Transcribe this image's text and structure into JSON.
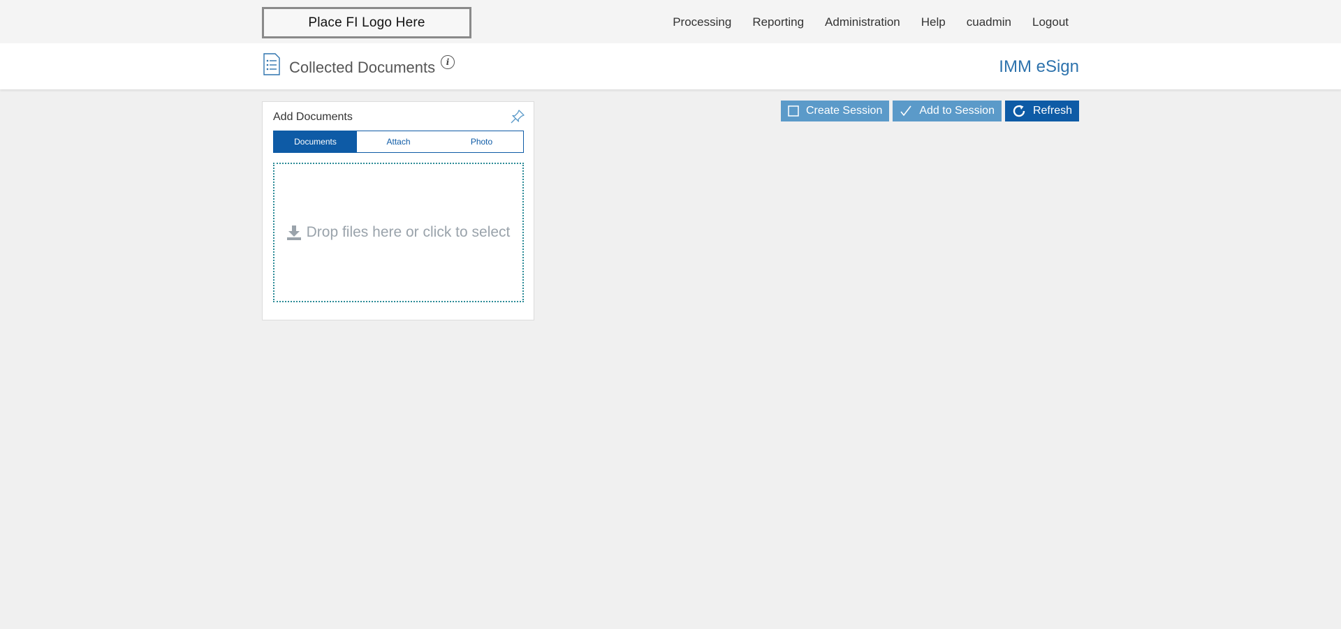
{
  "header": {
    "logo_text": "Place FI Logo Here",
    "nav": [
      "Processing",
      "Reporting",
      "Administration",
      "Help",
      "cuadmin",
      "Logout"
    ]
  },
  "page": {
    "title": "Collected Documents",
    "info_glyph": "i",
    "app_name": "IMM eSign"
  },
  "actions": {
    "create_session": "Create Session",
    "add_to_session": "Add to Session",
    "refresh": "Refresh"
  },
  "panel": {
    "title": "Add Documents",
    "tabs": [
      "Documents",
      "Attach",
      "Photo"
    ],
    "active_tab": "Documents",
    "drop_text": "Drop files here or click to select"
  },
  "colors": {
    "primary": "#0e5ba6",
    "button_light": "#5b9ac9",
    "app_name": "#2e73ad",
    "dropzone_border": "#2a8a96"
  },
  "icons": {
    "page_icon": "document-list-icon",
    "info": "info-icon",
    "pin": "pin-icon",
    "create_session": "square-icon",
    "add_to_session": "checkmark-icon",
    "refresh": "refresh-icon",
    "drop": "download-icon"
  }
}
